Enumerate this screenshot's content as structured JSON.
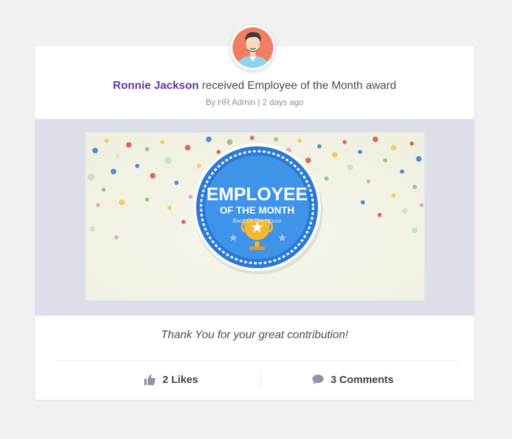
{
  "post": {
    "recipient_name": "Ronnie Jackson",
    "headline_rest": " received Employee of the Month award",
    "meta": "By HR Admin | 2 days ago",
    "caption": "Thank You for your great contribution!"
  },
  "banner": {
    "line1": "EMPLOYEE",
    "line2": "OF THE MONTH",
    "subtitle": "Back Of The House"
  },
  "actions": {
    "likes": "2 Likes",
    "comments": "3 Comments"
  },
  "icons": {
    "avatar": "person-avatar-icon",
    "like": "thumbs-up-icon",
    "comment": "speech-bubble-icon",
    "trophy": "trophy-icon"
  },
  "colors": {
    "name": "#5b3a9e",
    "badge_blue": "#2b7ad6",
    "avatar_bg": "#f07e62",
    "banner_bg": "#dcdfe9"
  }
}
